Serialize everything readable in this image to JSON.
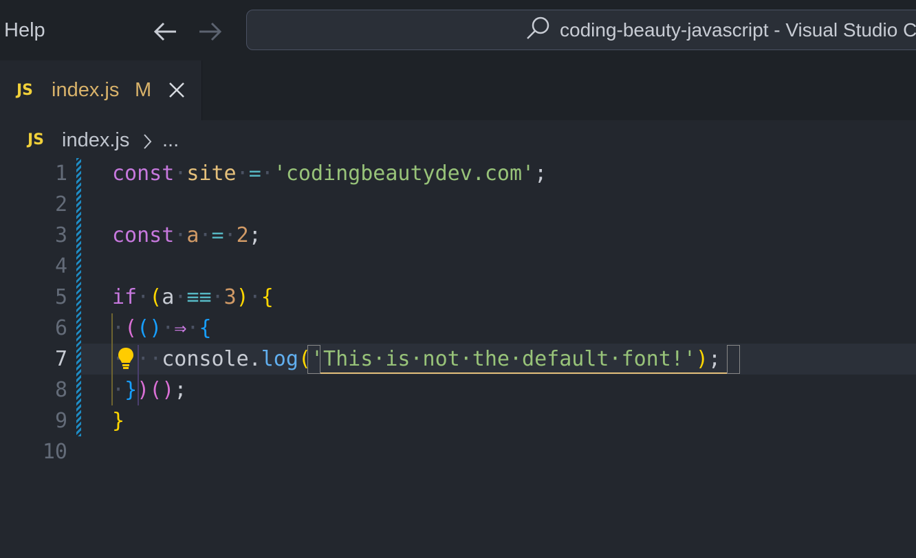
{
  "menu": {
    "help": "Help"
  },
  "command_center": {
    "title": "coding-beauty-javascript - Visual Studio Code"
  },
  "tab": {
    "icon": "JS",
    "filename": "index.js",
    "status": "M"
  },
  "breadcrumb": {
    "icon": "JS",
    "file": "index.js",
    "more": "..."
  },
  "editor": {
    "line_numbers": [
      "1",
      "2",
      "3",
      "4",
      "5",
      "6",
      "7",
      "8",
      "9",
      "10"
    ],
    "active_line": 7
  },
  "colors": {
    "keyword": "#c678dd",
    "variable": "#e5c07b",
    "string": "#98c379",
    "number": "#d19a66",
    "operator": "#56b6c2",
    "function": "#61afef",
    "js_icon": "#f0d03a",
    "git_gutter": "#1e8bc3"
  },
  "icons": [
    "arrow-left-icon",
    "arrow-right-icon",
    "search-icon",
    "close-icon",
    "chevron-right-icon",
    "lightbulb-icon"
  ]
}
